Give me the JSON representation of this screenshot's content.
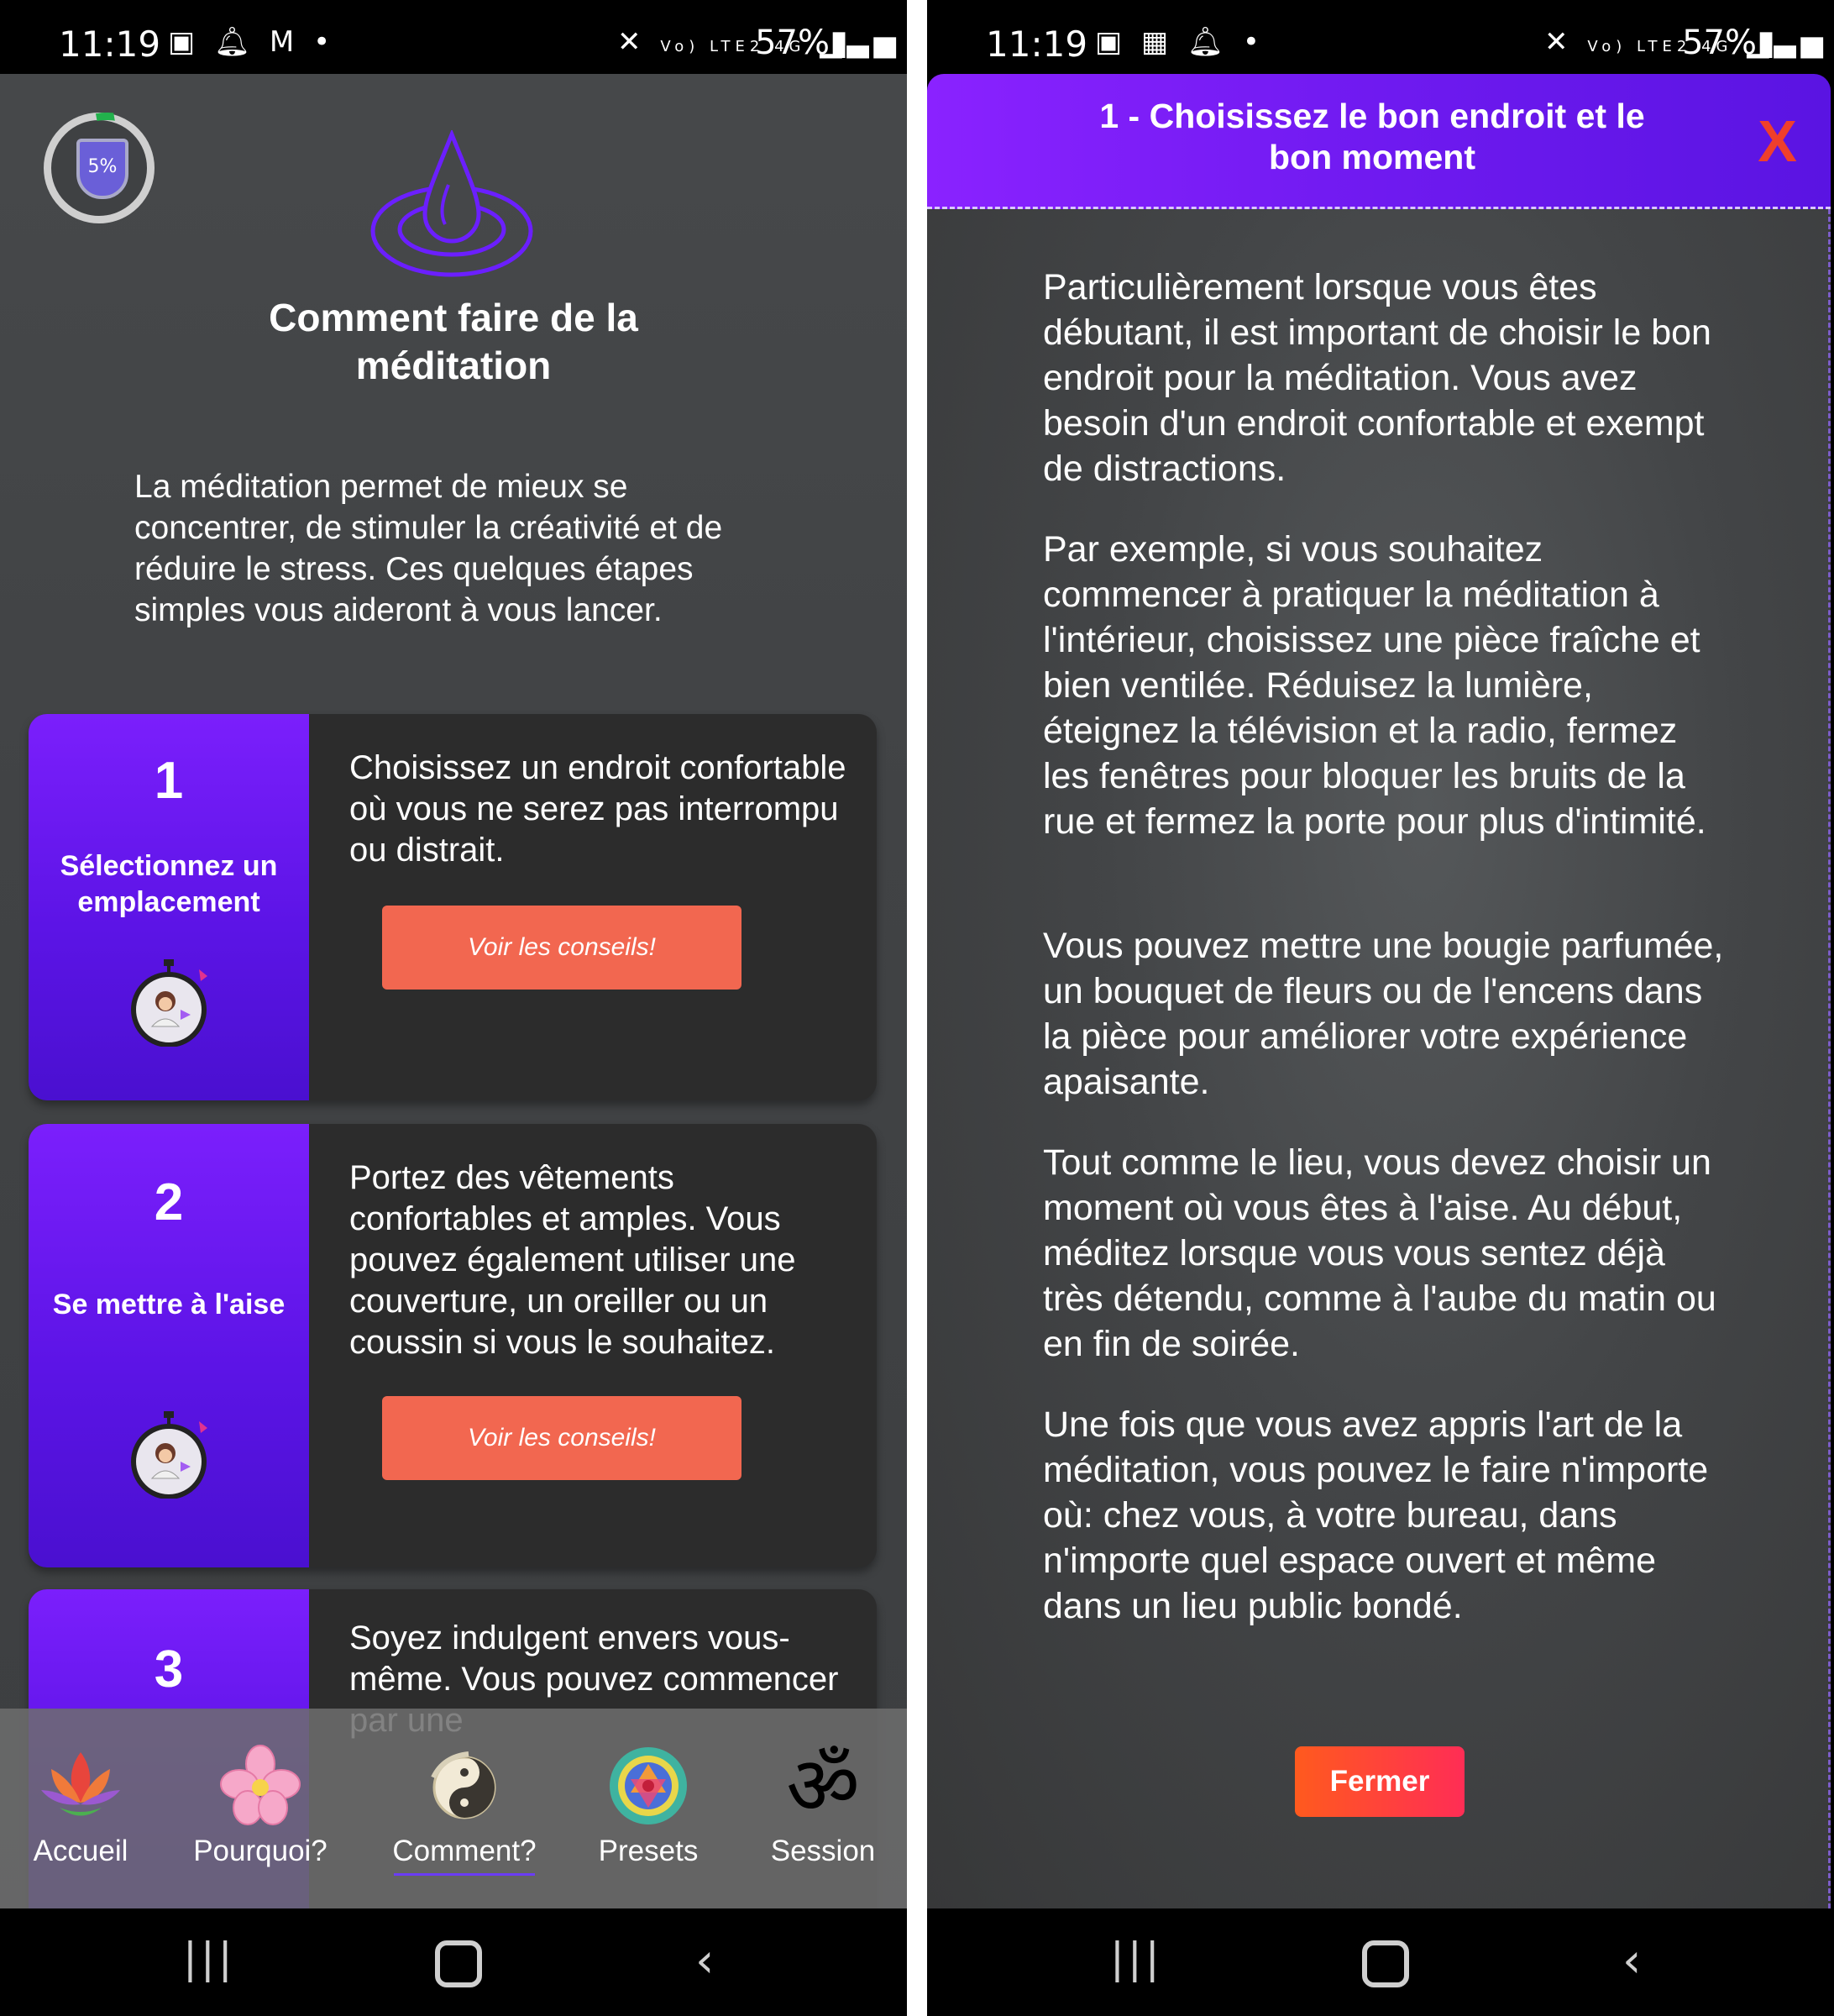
{
  "status_bar": {
    "time": "11:19",
    "signal": "Vo) LTE2 4G",
    "battery": "57%"
  },
  "left_screen": {
    "progress_badge": "5%",
    "title": "Comment faire de la méditation",
    "intro": "La méditation permet de mieux se concentrer, de stimuler la créativité et de réduire le stress. Ces quelques étapes simples vous aideront à vous lancer.",
    "steps": [
      {
        "number": "1",
        "label": "Sélectionnez un emplacement",
        "description": "Choisissez un endroit confortable où vous ne serez pas interrompu ou distrait.",
        "button": "Voir les conseils!"
      },
      {
        "number": "2",
        "label": "Se mettre à l'aise",
        "description": "Portez des vêtements confortables et amples. Vous pouvez également utiliser une couverture, un oreiller ou un coussin si vous le souhaitez.",
        "button": "Voir les conseils!"
      },
      {
        "number": "3",
        "description": "Soyez indulgent envers vous-même. Vous pouvez commencer par une"
      }
    ],
    "tabs": [
      {
        "label": "Accueil",
        "icon": "lotus-icon"
      },
      {
        "label": "Pourquoi?",
        "icon": "flower-icon"
      },
      {
        "label": "Comment?",
        "icon": "yin-yang-icon",
        "active": true
      },
      {
        "label": "Presets",
        "icon": "mandala-icon"
      },
      {
        "label": "Session",
        "icon": "om-icon"
      }
    ]
  },
  "right_screen": {
    "modal_title": "1 - Choisissez le bon endroit et le bon moment",
    "close_label": "X",
    "paragraphs": [
      "Particulièrement lorsque vous êtes débutant, il est important de choisir le bon endroit pour la méditation. Vous avez besoin d'un endroit confortable et exempt de distractions.",
      "Par exemple, si vous souhaitez commencer à pratiquer la méditation à l'intérieur, choisissez une pièce fraîche et bien ventilée. Réduisez la lumière, éteignez la télévision et la radio, fermez les fenêtres pour bloquer les bruits de la rue et fermez la porte pour plus d'intimité.",
      "Vous pouvez mettre une bougie parfumée, un bouquet de fleurs ou de l'encens dans la pièce pour améliorer votre expérience apaisante.",
      "Tout comme le lieu, vous devez choisir un moment où vous êtes à l'aise. Au début, méditez lorsque vous vous sentez déjà très détendu, comme à l'aube du matin ou en fin de soirée.",
      "Une fois que vous avez appris l'art de la méditation, vous pouvez le faire n'importe où: chez vous, à votre bureau, dans n'importe quel espace ouvert et même dans un lieu public bondé."
    ],
    "close_button": "Fermer"
  },
  "colors": {
    "accent_purple": "#7b1ffc",
    "button_coral": "#f26750",
    "close_red": "#ef3f2c"
  }
}
